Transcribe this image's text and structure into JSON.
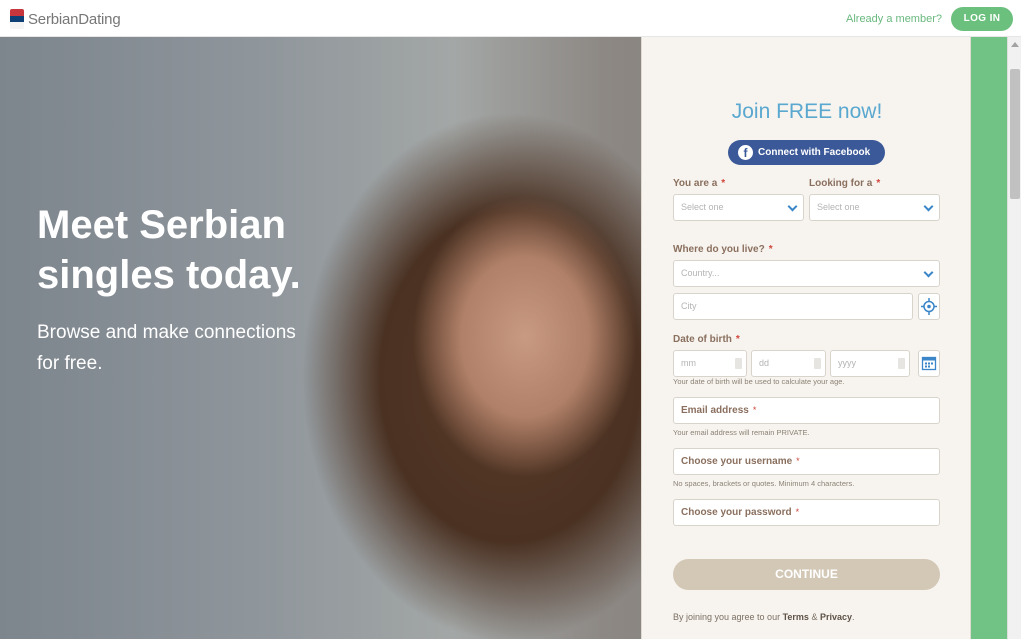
{
  "header": {
    "logo_text": "SerbianDating",
    "member_question": "Already a member?",
    "login_label": "LOG IN"
  },
  "hero": {
    "headline": "Meet Serbian singles today.",
    "subline": "Browse and make connections for free."
  },
  "form": {
    "title": "Join FREE now!",
    "facebook_label": "Connect with Facebook",
    "you_are_label": "You are a",
    "you_are_value": "Select one",
    "looking_for_label": "Looking for a",
    "looking_for_value": "Select one",
    "location_label": "Where do you live?",
    "country_placeholder": "Country...",
    "city_placeholder": "City",
    "dob_label": "Date of birth",
    "dob_mm": "mm",
    "dob_dd": "dd",
    "dob_yyyy": "yyyy",
    "dob_hint": "Your date of birth will be used to calculate your age.",
    "email_label": "Email address",
    "email_hint": "Your email address will remain PRIVATE.",
    "username_label": "Choose your username",
    "username_hint": "No spaces, brackets or quotes. Minimum 4 characters.",
    "password_label": "Choose your password",
    "continue_label": "CONTINUE",
    "terms_prefix": "By joining you agree to our",
    "terms_link": "Terms",
    "terms_and": "&",
    "privacy_link": "Privacy",
    "terms_suffix": ".",
    "required_mark": "*"
  },
  "icons": {
    "logo": "serbian-flag-icon",
    "facebook": "facebook-icon",
    "locate": "crosshair-location-icon",
    "calendar": "calendar-icon",
    "dropdown": "chevron-down-icon"
  },
  "colors": {
    "accent_green": "#6cc07e",
    "title_blue": "#5aa8cf",
    "facebook_blue": "#3b5998",
    "required_red": "#d0453b",
    "continue_tan": "#d3c8b6"
  }
}
